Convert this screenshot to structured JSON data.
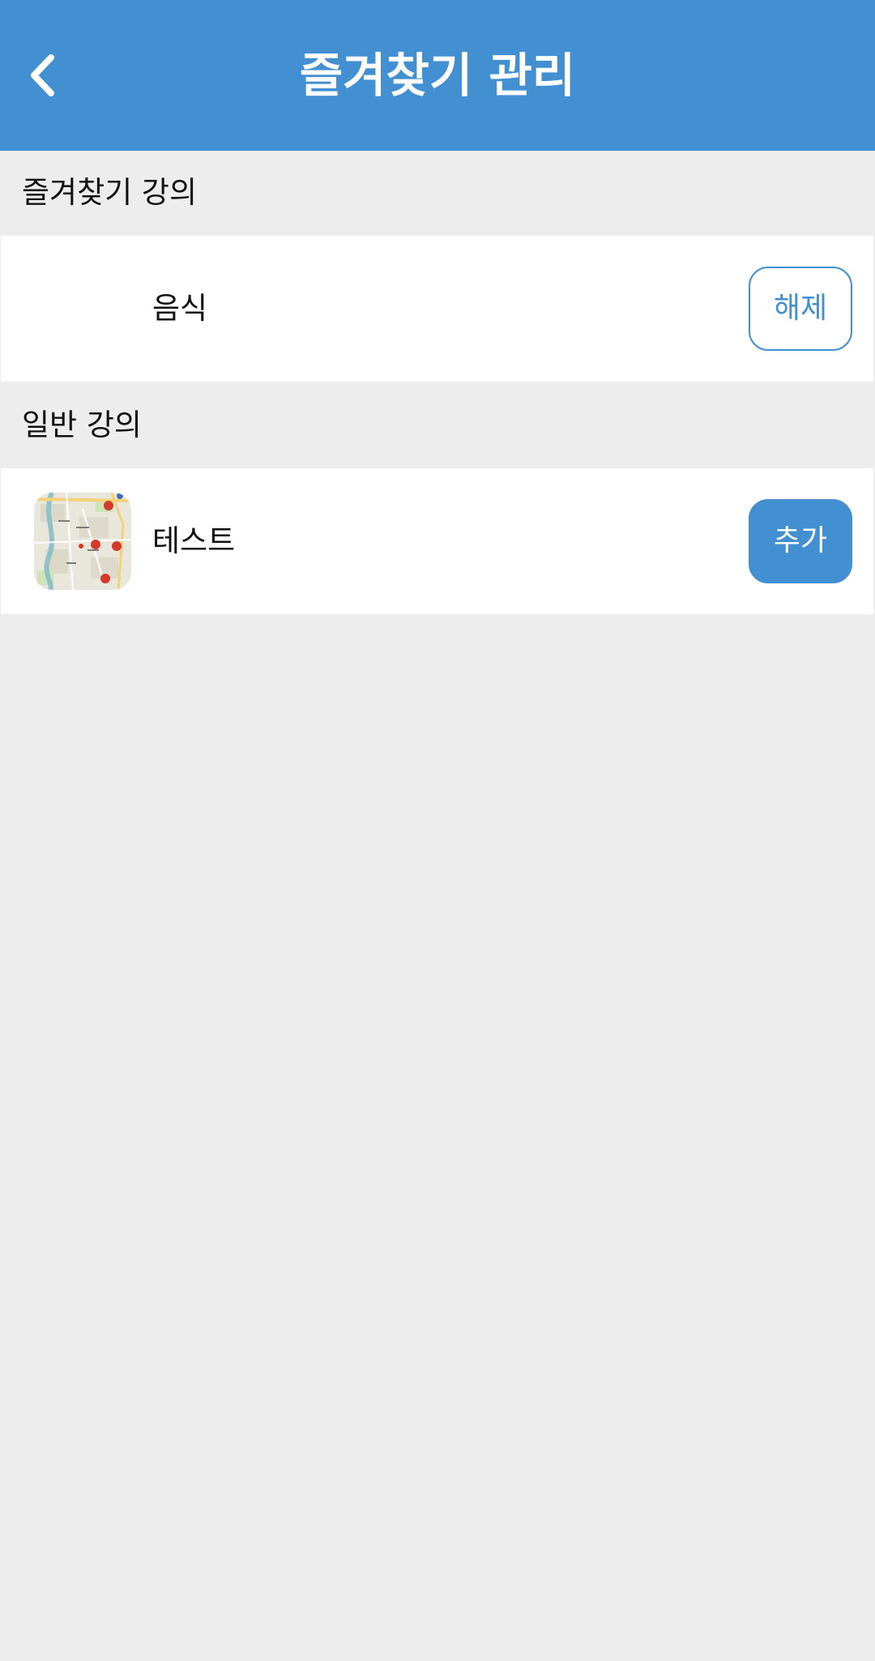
{
  "header": {
    "title": "즐겨찾기 관리",
    "back_icon": "chevron-left-icon",
    "background": "#428fd2"
  },
  "sections": {
    "favorites": {
      "title": "즐겨찾기 강의",
      "items": [
        {
          "label": "음식",
          "button_label": "해제"
        }
      ]
    },
    "general": {
      "title": "일반 강의",
      "items": [
        {
          "label": "테스트",
          "thumbnail": "map-thumbnail",
          "button_label": "추가"
        }
      ]
    }
  },
  "colors": {
    "accent": "#428fd2",
    "page_background": "#ededed",
    "row_background": "#ffffff"
  }
}
